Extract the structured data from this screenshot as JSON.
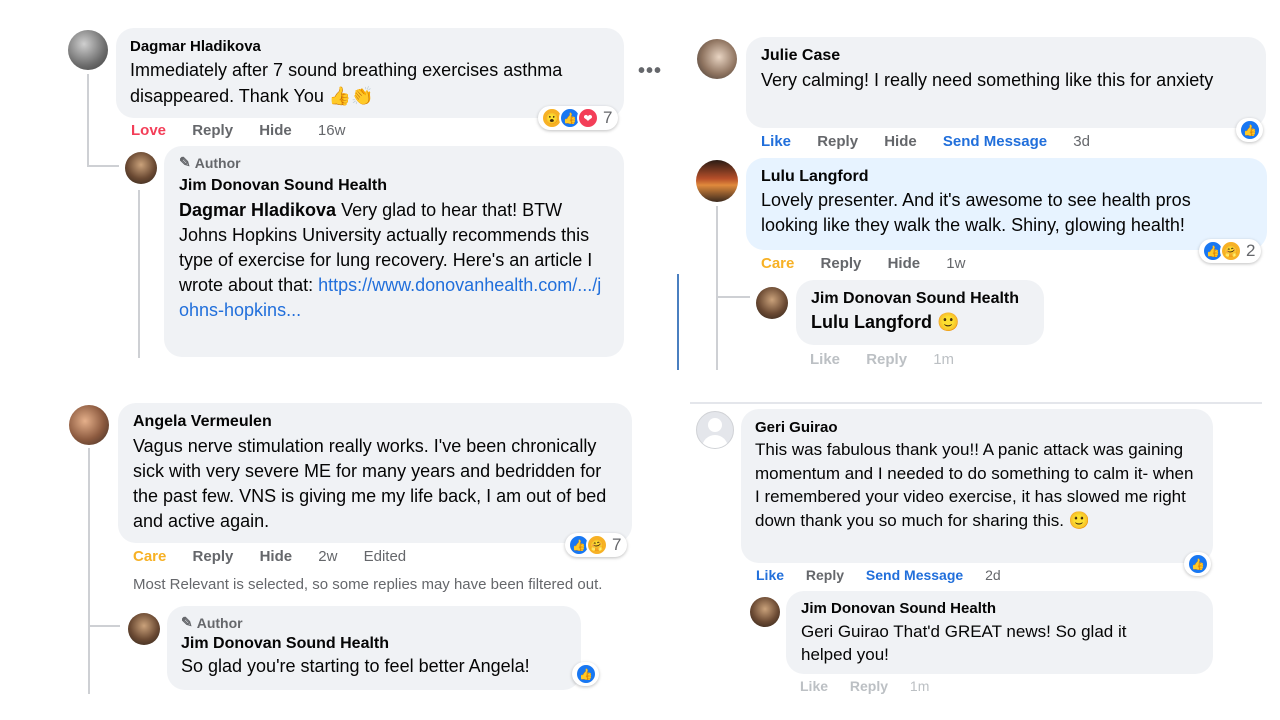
{
  "left_top": {
    "name": "Dagmar Hladikova",
    "text": "Immediately after 7 sound breathing exercises asthma disappeared. Thank You 👍👏",
    "actions": [
      "Love",
      "Reply",
      "Hide"
    ],
    "time": "16w",
    "reactions_count": "7",
    "more": "•••",
    "reply": {
      "badge": "Author",
      "name": "Jim Donovan Sound Health",
      "mention": "Dagmar Hladikova",
      "text": " Very glad to hear that! BTW Johns Hopkins University actually recommends this type of exercise for lung recovery. Here's an article I wrote about that:",
      "link": "https://www.donovanhealth.com/.../johns-hopkins..."
    }
  },
  "left_bottom": {
    "name": "Angela Vermeulen",
    "text": "Vagus nerve stimulation really works. I've been chronically sick with very severe ME for many years and bedridden for the past few. VNS is giving me my life back, I am out of bed and active again.",
    "actions": [
      "Care",
      "Reply",
      "Hide"
    ],
    "time": "2w",
    "edited": "Edited",
    "reactions_count": "7",
    "filter_note": "Most Relevant is selected, so some replies may have been filtered out.",
    "reply": {
      "badge": "Author",
      "name": "Jim Donovan Sound Health",
      "text": "So glad you're starting to feel better Angela!"
    }
  },
  "right_top": {
    "name": "Julie Case",
    "text": "Very calming! I really need something like this for anxiety",
    "actions": [
      "Like",
      "Reply",
      "Hide",
      "Send Message"
    ],
    "time": "3d"
  },
  "right_mid": {
    "name": "Lulu Langford",
    "text": "Lovely presenter. And it's awesome to see health pros looking like they walk the walk. Shiny, glowing health!",
    "actions": [
      "Care",
      "Reply",
      "Hide"
    ],
    "time": "1w",
    "reactions_count": "2",
    "reply": {
      "name": "Jim Donovan Sound Health",
      "text": "Lulu Langford 🙂",
      "actions": [
        "Like",
        "Reply"
      ],
      "time": "1m"
    }
  },
  "right_bottom": {
    "name": "Geri Guirao",
    "text": "This was fabulous thank you!! A panic attack was gaining momentum and I needed to do something to calm it- when I remembered your video exercise, it has slowed me right down thank you so much for sharing this. 🙂",
    "actions": [
      "Like",
      "Reply",
      "Send Message"
    ],
    "time": "2d",
    "reply": {
      "name": "Jim Donovan Sound Health",
      "text": "Geri Guirao That'd GREAT news! So glad it helped you!",
      "actions": [
        "Like",
        "Reply"
      ],
      "time": "1m"
    }
  },
  "icons": {
    "like": "👍",
    "love": "❤",
    "wow": "😮",
    "care": "🤗",
    "pencil": "✎"
  },
  "colors": {
    "bubble": "#f0f2f5",
    "highlight": "#e7f3ff",
    "link": "#216fdb",
    "love": "#f33e58",
    "care": "#f7b125",
    "muted": "#65676b"
  }
}
